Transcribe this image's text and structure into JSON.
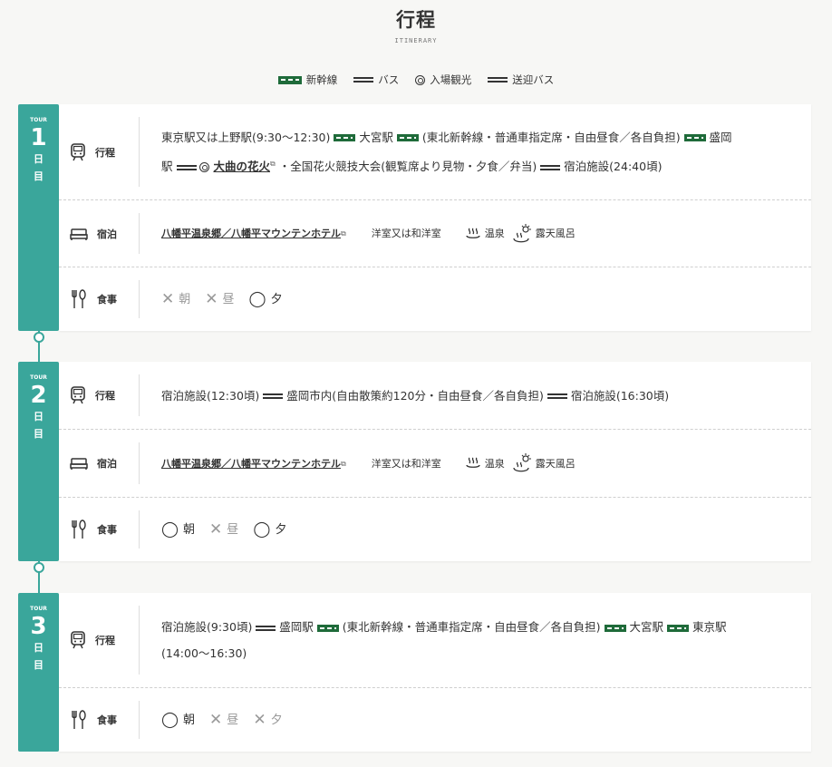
{
  "header": {
    "title": "行程",
    "subtitle": "ITINERARY"
  },
  "legend": [
    {
      "icon": "shinkansen-icon",
      "label": "新幹線"
    },
    {
      "icon": "bus-icon",
      "label": "バス"
    },
    {
      "icon": "admission-sightseeing-icon",
      "label": "入場観光"
    },
    {
      "icon": "shuttle-bus-icon",
      "label": "送迎バス"
    }
  ],
  "days": [
    {
      "tour_label": "TOUR",
      "number": "1",
      "char1": "日",
      "char2": "目",
      "itinerary_label": "行程",
      "itinerary": {
        "s1": "東京駅又は上野駅(9:30〜12:30)",
        "s2": "大宮駅",
        "s3": "(東北新幹線・普通車指定席・自由昼食／各自負担)",
        "s4": "盛岡",
        "s5": "駅",
        "link": "大曲の花火",
        "s6": "・全国花火競技大会(観覧席より見物・夕食／弁当)",
        "s7": "宿泊施設(24:40頃)"
      },
      "stay_label": "宿泊",
      "stay": {
        "hotel": "八幡平温泉郷／八幡平マウンテンホテル",
        "room": "洋室又は和洋室",
        "onsen": "温泉",
        "roten": "露天風呂"
      },
      "meal_label": "食事",
      "meals": [
        {
          "mark": "✕",
          "name": "朝",
          "served": false
        },
        {
          "mark": "✕",
          "name": "昼",
          "served": false
        },
        {
          "mark": "◯",
          "name": "夕",
          "served": true
        }
      ]
    },
    {
      "tour_label": "TOUR",
      "number": "2",
      "char1": "日",
      "char2": "目",
      "itinerary_label": "行程",
      "itinerary": {
        "s1": "宿泊施設(12:30頃)",
        "s2": "盛岡市内(自由散策約120分・自由昼食／各自負担)",
        "s3": "宿泊施設(16:30頃)"
      },
      "stay_label": "宿泊",
      "stay": {
        "hotel": "八幡平温泉郷／八幡平マウンテンホテル",
        "room": "洋室又は和洋室",
        "onsen": "温泉",
        "roten": "露天風呂"
      },
      "meal_label": "食事",
      "meals": [
        {
          "mark": "◯",
          "name": "朝",
          "served": true
        },
        {
          "mark": "✕",
          "name": "昼",
          "served": false
        },
        {
          "mark": "◯",
          "name": "夕",
          "served": true
        }
      ]
    },
    {
      "tour_label": "TOUR",
      "number": "3",
      "char1": "日",
      "char2": "目",
      "itinerary_label": "行程",
      "itinerary": {
        "s1": "宿泊施設(9:30頃)",
        "s2": "盛岡駅",
        "s3": "(東北新幹線・普通車指定席・自由昼食／各自負担)",
        "s4": "大宮駅",
        "s5": "東京駅",
        "s6": "(14:00〜16:30)"
      },
      "meal_label": "食事",
      "meals": [
        {
          "mark": "◯",
          "name": "朝",
          "served": true
        },
        {
          "mark": "✕",
          "name": "昼",
          "served": false
        },
        {
          "mark": "✕",
          "name": "夕",
          "served": false
        }
      ]
    }
  ]
}
